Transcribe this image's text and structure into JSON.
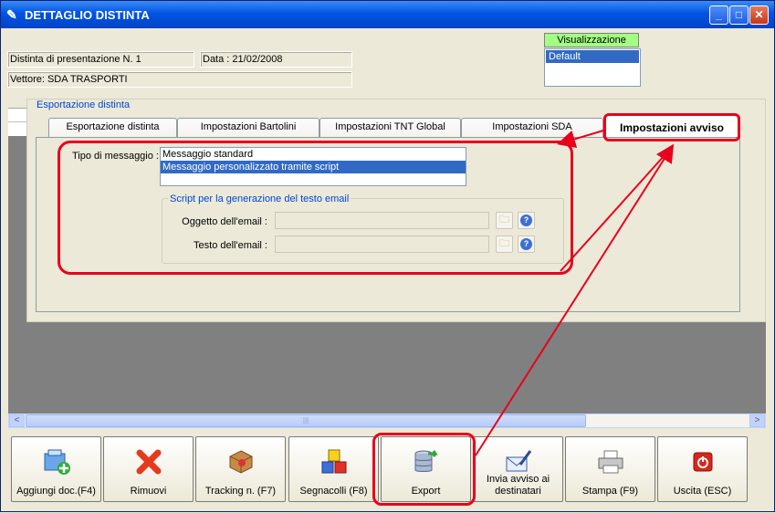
{
  "window": {
    "title": "DETTAGLIO DISTINTA",
    "minimize": "_",
    "maximize": "□",
    "close": "✕"
  },
  "header": {
    "distinta": "Distinta di presentazione N. 1",
    "data": "Data : 21/02/2008",
    "vettore": "Vettore: SDA TRASPORTI"
  },
  "visualizzazione": {
    "title": "Visualizzazione",
    "selected": "Default"
  },
  "export_panel": {
    "legend": "Esportazione distinta",
    "tabs": [
      {
        "label": "Esportazione distinta"
      },
      {
        "label": "Impostazioni Bartolini"
      },
      {
        "label": "Impostazioni TNT Global"
      },
      {
        "label": "Impostazioni SDA"
      },
      {
        "label": "Impostazioni avviso"
      }
    ],
    "tipo_label": "Tipo di messaggio :",
    "tipo_options": [
      "Messaggio standard",
      "Messaggio personalizzato tramite script"
    ],
    "script_legend": "Script per la generazione del testo email",
    "oggetto_label": "Oggetto dell'email :",
    "testo_label": "Testo dell'email :"
  },
  "scrollbar": {
    "left": "<",
    "right": ">",
    "grip": "|||"
  },
  "toolbar": {
    "buttons": [
      {
        "label": "Aggiungi doc.(F4)",
        "icon": "add-document-icon"
      },
      {
        "label": "Rimuovi",
        "icon": "red-x-icon"
      },
      {
        "label": "Tracking n. (F7)",
        "icon": "package-icon"
      },
      {
        "label": "Segnacolli (F8)",
        "icon": "cubes-icon"
      },
      {
        "label": "Export",
        "icon": "database-export-icon"
      },
      {
        "label": "Invia avviso ai destinatari",
        "icon": "envelope-pen-icon"
      },
      {
        "label": "Stampa (F9)",
        "icon": "printer-icon"
      },
      {
        "label": "Uscita (ESC)",
        "icon": "power-icon"
      }
    ]
  },
  "colors": {
    "highlight": "#e8001c",
    "selection": "#316ac5",
    "visualizzazione_header": "#a3ff84"
  }
}
